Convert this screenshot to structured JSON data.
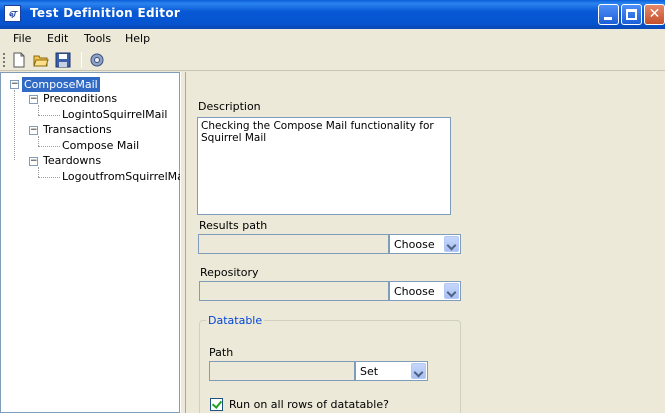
{
  "window": {
    "title": "Test Definition Editor",
    "app_icon_text": "ஏ"
  },
  "menu": [
    "File",
    "Edit",
    "Tools",
    "Help"
  ],
  "toolbar": {
    "icons": [
      "new-document-icon",
      "open-folder-icon",
      "save-icon",
      "settings-icon"
    ]
  },
  "tree": {
    "root": "ComposeMail",
    "sections": [
      {
        "label": "Preconditions",
        "children": [
          "LogintoSquirrelMail"
        ]
      },
      {
        "label": "Transactions",
        "children": [
          "Compose Mail"
        ]
      },
      {
        "label": "Teardowns",
        "children": [
          "LogoutfromSquirrelMail"
        ]
      }
    ]
  },
  "form": {
    "description_label": "Description",
    "description_value": "Checking the Compose Mail functionality for  Squirrel Mail",
    "results_path_label": "Results path",
    "results_path_value": "",
    "results_path_button": "Choose",
    "repository_label": "Repository",
    "repository_value": "",
    "repository_button": "Choose",
    "datatable": {
      "group_title": "Datatable",
      "path_label": "Path",
      "path_value": "",
      "path_button": "Set",
      "run_all_rows_label": "Run on all rows of datatable?",
      "run_all_rows_checked": true
    }
  },
  "colors": {
    "titlebar": "#0858d6",
    "selection": "#316ac5",
    "group_title": "#0046d5",
    "window_bg": "#ece9d8"
  }
}
